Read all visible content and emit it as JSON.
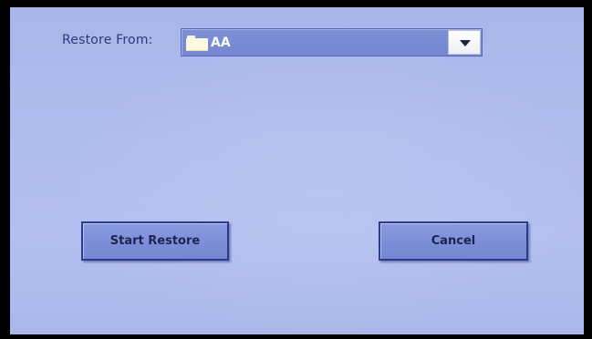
{
  "restore": {
    "label": "Restore From:",
    "selected_source": "AA",
    "source_icon": "folder-icon",
    "dropdown_icon": "chevron-down-icon"
  },
  "actions": {
    "start_label": "Start Restore",
    "cancel_label": "Cancel"
  },
  "colors": {
    "background": "#aebbed",
    "select_fill": "#7a8cd4",
    "button_fill": "#8193dc",
    "button_border": "#2a3a8c",
    "label_text": "#2a3a7a"
  }
}
